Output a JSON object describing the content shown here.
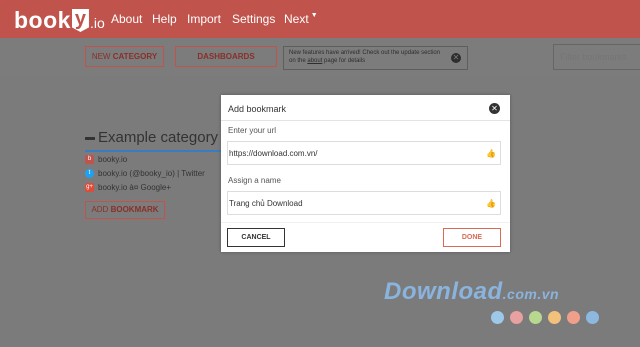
{
  "app": {
    "logo_prefix": "book",
    "logo_y": "y",
    "logo_suffix": ".io",
    "nav": [
      "About",
      "Help",
      "Import",
      "Settings",
      "Next"
    ]
  },
  "toolbar": {
    "new_category_prefix": "NEW",
    "new_category_bold": "CATEGORY",
    "dashboards": "DASHBOARDS",
    "notice_text_1": "New features have arrived! Check out the update section on the",
    "notice_link": "about",
    "notice_text_2": "page for details",
    "filter_placeholder": "Filter bookmarks"
  },
  "category": {
    "title": "Example category",
    "links": [
      {
        "label": "booky.io",
        "icon": "booky-favicon",
        "color": "#c0534b"
      },
      {
        "label": "booky.io (@booky_io) | Twitter",
        "icon": "twitter-bird-icon",
        "color": "#1da1f2"
      },
      {
        "label": "booky.io à¤ Google+",
        "icon": "google-plus-icon",
        "color": "#dd4b39"
      }
    ],
    "add_prefix": "ADD",
    "add_bold": "BOOKMARK"
  },
  "modal": {
    "title": "Add bookmark",
    "url_label": "Enter your url",
    "url_value": "https://download.com.vn/",
    "name_label": "Assign a name",
    "name_value": "Trang chủ Download",
    "cancel": "CANCEL",
    "done": "DONE"
  },
  "watermark": {
    "text": "Download",
    "suffix": ".com.vn",
    "dot_colors": [
      "#9ec8e8",
      "#e8a0a0",
      "#b7d88e",
      "#f2c27c",
      "#f0a08a",
      "#8db8e0"
    ]
  }
}
